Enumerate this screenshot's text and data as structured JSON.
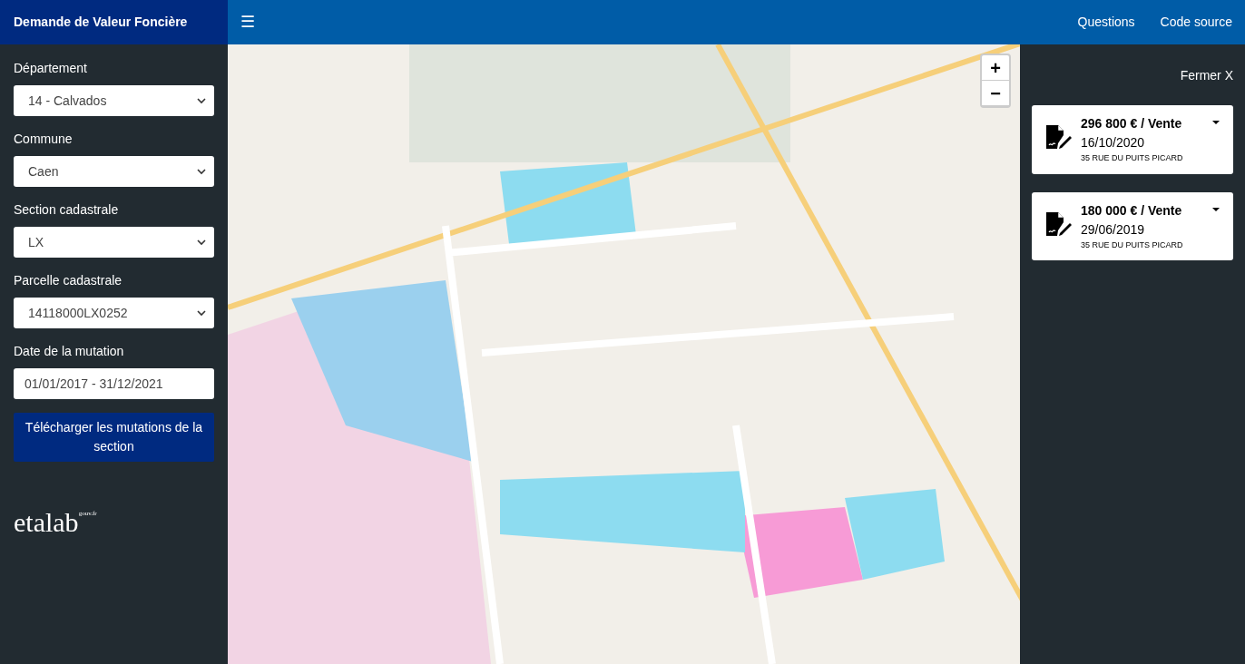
{
  "app_title": "Demande de Valeur Foncière",
  "menu_toggle": "☰",
  "nav_links": [
    "Questions",
    "Code source"
  ],
  "filters": [
    {
      "label": "Département",
      "kind": "select",
      "value": "14 - Calvados"
    },
    {
      "label": "Commune",
      "kind": "select",
      "value": "Caen"
    },
    {
      "label": "Section cadastrale",
      "kind": "select",
      "value": "LX"
    },
    {
      "label": "Parcelle cadastrale",
      "kind": "select",
      "value": "14118000LX0252"
    },
    {
      "label": "Date de la mutation",
      "kind": "input",
      "value": "01/01/2017 - 31/12/2021"
    }
  ],
  "download_button": "Télécharger les mutations de la section",
  "logo": {
    "name": "etalab",
    "sup": "gouv.fr"
  },
  "map_zoom": [
    "+",
    "−"
  ],
  "close_label": "Fermer X",
  "mutations": [
    {
      "price": "296 800 € / Vente",
      "date": "16/10/2020",
      "address": "35 RUE DU PUITS PICARD",
      "expanded": false
    },
    {
      "price": "180 000 € / Vente",
      "date": "29/06/2019",
      "address": "35 RUE DU PUITS PICARD",
      "expanded": false
    }
  ]
}
